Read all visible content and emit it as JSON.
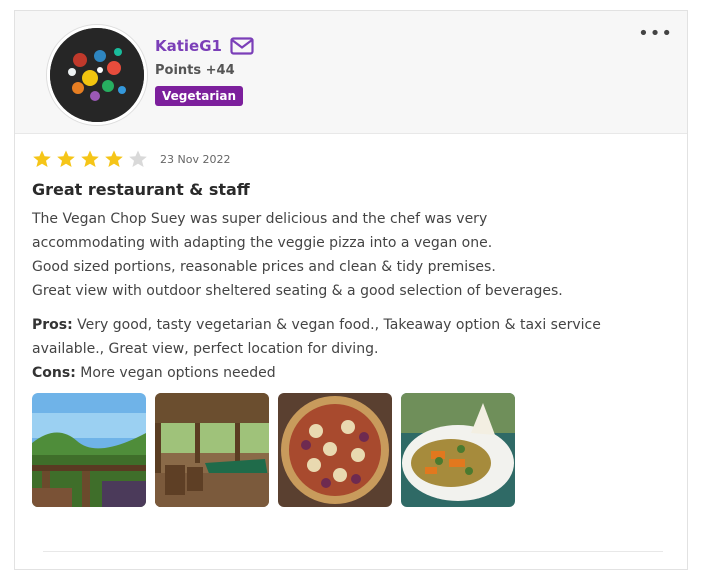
{
  "user": {
    "username": "KatieG1",
    "points": "Points +44",
    "badge": "Vegetarian",
    "icons": {
      "message": "mail-icon",
      "more": "more-options-icon"
    }
  },
  "review": {
    "rating": 4,
    "rating_max": 5,
    "date": "23 Nov 2022",
    "title": "Great restaurant & staff",
    "body_lines": [
      "The Vegan Chop Suey was super delicious and the chef was very",
      "accommodating with adapting the veggie pizza into a vegan one.",
      "Good sized portions, reasonable prices and clean & tidy premises.",
      "Great view with outdoor sheltered seating & a good selection of beverages."
    ],
    "pros_label": "Pros:",
    "pros_text": "Very good, tasty vegetarian & vegan food., Takeaway option & taxi service available., Great view, perfect location for diving.",
    "cons_label": "Cons:",
    "cons_text": "More vegan options needed",
    "photos": [
      "view-photo",
      "interior-photo",
      "pizza-photo",
      "dish-photo"
    ]
  },
  "colors": {
    "username": "#7b3fb8",
    "badge": "#7c1f9c",
    "star_filled": "#f5c518",
    "star_empty": "#d9d9d9"
  }
}
